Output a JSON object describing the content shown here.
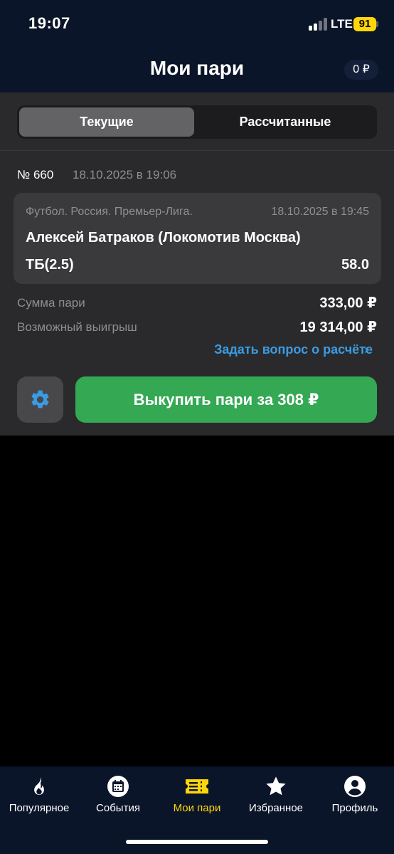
{
  "status_bar": {
    "time": "19:07",
    "network": "LTE",
    "battery": "91"
  },
  "header": {
    "title": "Мои пари",
    "balance": "0 ₽"
  },
  "tabs": [
    {
      "label": "Текущие",
      "active": true
    },
    {
      "label": "Рассчитанные",
      "active": false
    }
  ],
  "bet": {
    "number": "№ 660",
    "date": "18.10.2025 в 19:06",
    "league": "Футбол. Россия. Премьер-Лига.",
    "event_time": "18.10.2025 в 19:45",
    "selection": "Алексей Батраков (Локомотив Москва)",
    "outcome": "ТБ(2.5)",
    "odds": "58.0",
    "stake_label": "Сумма пари",
    "stake_value": "333,00  ₽",
    "win_label": "Возможный выигрыш",
    "win_value": "19 314,00  ₽",
    "ask_link": "Задать вопрос о расчёте",
    "buyout_button": "Выкупить пари за  308 ₽"
  },
  "bottom_nav": [
    {
      "label": "Популярное",
      "icon": "flame-icon",
      "active": false
    },
    {
      "label": "События",
      "icon": "calendar-icon",
      "active": false
    },
    {
      "label": "Мои пари",
      "icon": "ticket-icon",
      "active": true
    },
    {
      "label": "Избранное",
      "icon": "star-icon",
      "active": false
    },
    {
      "label": "Профиль",
      "icon": "profile-icon",
      "active": false
    }
  ],
  "colors": {
    "header_bg": "#0b1529",
    "panel_bg": "#2a2a2c",
    "card_bg": "#3a3a3c",
    "accent_green": "#34a853",
    "accent_yellow": "#ffd60a",
    "link_blue": "#3b9be3"
  }
}
